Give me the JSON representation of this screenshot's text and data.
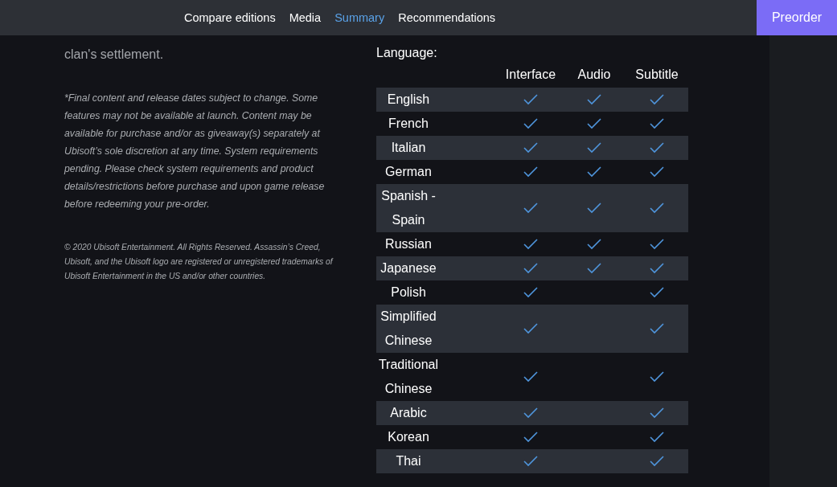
{
  "nav": {
    "items": [
      {
        "label": "Compare editions",
        "selected": false
      },
      {
        "label": "Media",
        "selected": false
      },
      {
        "label": "Summary",
        "selected": true
      },
      {
        "label": "Recommendations",
        "selected": false
      }
    ],
    "button": "Preorder"
  },
  "bullet": "clan's settlement.",
  "disclaimer": "*Final content and release dates subject to change. Some features may not be available at launch. Content may be available for purchase and/or as giveaway(s) separately at Ubisoft’s sole discretion at any time. System requirements pending. Please check system requirements and product details/restrictions before purchase and upon game release before redeeming your pre-order.",
  "copyright": "© 2020 Ubisoft Entertainment. All Rights Reserved. Assassin’s Creed, Ubisoft, and the Ubisoft logo are registered or unregistered trademarks of Ubisoft Entertainment in the US and/or other countries.",
  "languages": {
    "title": "Language:",
    "columns": [
      "Interface",
      "Audio",
      "Subtitle"
    ],
    "rows": [
      {
        "name": "English",
        "interface": true,
        "audio": true,
        "subtitle": true
      },
      {
        "name": "French",
        "interface": true,
        "audio": true,
        "subtitle": true
      },
      {
        "name": "Italian",
        "interface": true,
        "audio": true,
        "subtitle": true
      },
      {
        "name": "German",
        "interface": true,
        "audio": true,
        "subtitle": true
      },
      {
        "name": "Spanish - Spain",
        "interface": true,
        "audio": true,
        "subtitle": true
      },
      {
        "name": "Russian",
        "interface": true,
        "audio": true,
        "subtitle": true
      },
      {
        "name": "Japanese",
        "interface": true,
        "audio": true,
        "subtitle": true
      },
      {
        "name": "Polish",
        "interface": true,
        "audio": false,
        "subtitle": true
      },
      {
        "name": "Simplified Chinese",
        "interface": true,
        "audio": false,
        "subtitle": true
      },
      {
        "name": "Traditional Chinese",
        "interface": true,
        "audio": false,
        "subtitle": true
      },
      {
        "name": "Arabic",
        "interface": true,
        "audio": false,
        "subtitle": true
      },
      {
        "name": "Korean",
        "interface": true,
        "audio": false,
        "subtitle": true
      },
      {
        "name": "Thai",
        "interface": true,
        "audio": false,
        "subtitle": true
      }
    ]
  }
}
